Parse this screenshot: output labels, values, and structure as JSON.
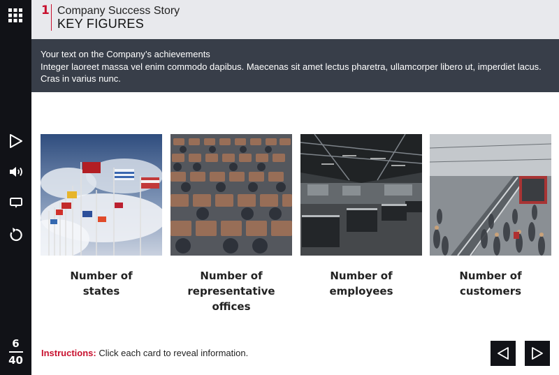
{
  "sidebar": {
    "icons": [
      "grid-menu-icon",
      "play-icon",
      "volume-icon",
      "subtitles-icon",
      "replay-icon"
    ],
    "page_current": "6",
    "page_total": "40"
  },
  "header": {
    "slide_number": "1",
    "title": "Company Success Story",
    "subtitle": "KEY FIGURES"
  },
  "banner": {
    "line1": "Your text on the Company’s achievements",
    "line2": "Integer laoreet massa vel enim commodo dapibus. Maecenas sit amet lectus pharetra, ullamcorper libero ut, imperdiet lacus.",
    "line3": "Cras in varius nunc."
  },
  "cards": [
    {
      "line1": "Number of",
      "line2": "states",
      "line3": "",
      "image": "flags-photo"
    },
    {
      "line1": "Number of",
      "line2": "representative",
      "line3": "offices",
      "image": "auditorium-photo"
    },
    {
      "line1": "Number of",
      "line2": "employees",
      "line3": "",
      "image": "office-photo"
    },
    {
      "line1": "Number of",
      "line2": "customers",
      "line3": "",
      "image": "mall-crowd-photo"
    }
  ],
  "instructions": {
    "key": "Instructions:",
    "text": " Click each card to reveal information."
  },
  "colors": {
    "accent": "#c8102e",
    "sidebar": "#111217",
    "banner": "#383e49",
    "header": "#e8e9ed"
  }
}
